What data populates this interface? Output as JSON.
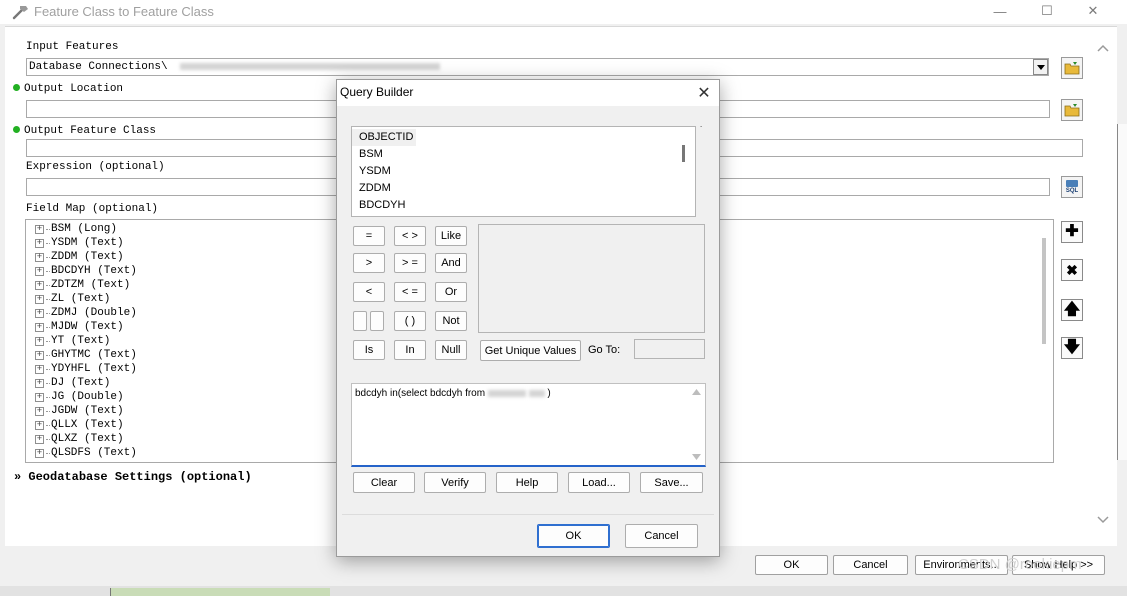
{
  "window": {
    "title": "Feature Class to Feature Class",
    "controls": {
      "minimize": "—",
      "maximize": "☐",
      "close": "✕"
    }
  },
  "form": {
    "input_features_label": "Input Features",
    "input_features_value": "Database Connections\\",
    "output_location_label": "Output Location",
    "output_feature_class_label": "Output Feature Class",
    "expression_label": "Expression (optional)",
    "field_map_label": "Field Map (optional)",
    "field_map_items": [
      "BSM (Long)",
      "YSDM (Text)",
      "ZDDM (Text)",
      "BDCDYH (Text)",
      "ZDTZM (Text)",
      "ZL (Text)",
      "ZDMJ (Double)",
      "MJDW (Text)",
      "YT (Text)",
      "GHYTMC (Text)",
      "YDYHFL (Text)",
      "DJ (Text)",
      "JG (Double)",
      "JGDW (Text)",
      "QLLX (Text)",
      "QLXZ (Text)",
      "QLSDFS (Text)"
    ],
    "geodatabase_settings_label": "Geodatabase Settings (optional)",
    "sql_icon_label": "SQL"
  },
  "bottom_buttons": {
    "ok": "OK",
    "cancel": "Cancel",
    "environments": "Environments...",
    "show_help": "Show Help >>"
  },
  "query_builder": {
    "title": "Query Builder",
    "fields": [
      "OBJECTID",
      "BSM",
      "YSDM",
      "ZDDM",
      "BDCDYH"
    ],
    "operators": {
      "eq": "=",
      "ne": "< >",
      "like": "Like",
      "gt": ">",
      "ge": "> =",
      "and": "And",
      "lt": "<",
      "le": "< =",
      "or": "Or",
      "paren": "( )",
      "not": "Not",
      "is": "Is",
      "in": "In",
      "null": "Null"
    },
    "get_unique_values": "Get Unique Values",
    "goto_label": "Go To:",
    "sql_text_prefix": "bdcdyh in(select bdcdyh from",
    "sql_text_suffix": ")",
    "buttons": {
      "clear": "Clear",
      "verify": "Verify",
      "help": "Help",
      "load": "Load...",
      "save": "Save..."
    },
    "ok": "OK",
    "cancel": "Cancel"
  },
  "watermark": "CSDN @rookiepm",
  "colors": {
    "required_dot": "#22b022",
    "sql_focus_border": "#2563c9",
    "folder_icon": "#e8b93a"
  }
}
